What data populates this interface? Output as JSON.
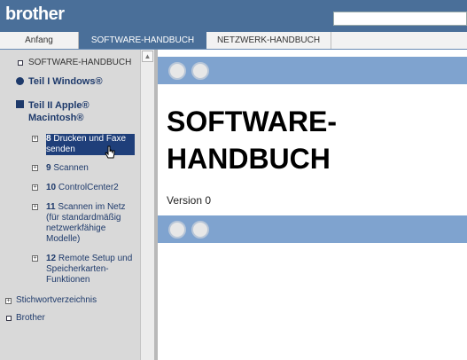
{
  "header": {
    "logo": "brother"
  },
  "tabs": [
    {
      "label": "Anfang"
    },
    {
      "label": "SOFTWARE-HANDBUCH"
    },
    {
      "label": "NETZWERK-HANDBUCH"
    }
  ],
  "sidebar": {
    "root": "SOFTWARE-HANDBUCH",
    "teil1": "Teil I Windows®",
    "teil2": "Teil II Apple® Macintosh®",
    "items": [
      {
        "num": "8",
        "label": "Drucken und Faxe senden",
        "selected": true
      },
      {
        "num": "9",
        "label": "Scannen"
      },
      {
        "num": "10",
        "label": "ControlCenter2"
      },
      {
        "num": "11",
        "label": "Scannen im Netz (für standardmäßig netzwerkfähige Modelle)"
      },
      {
        "num": "12",
        "label": "Remote Setup und Speicherkarten-Funktionen"
      }
    ],
    "index": "Stichwortverzeichnis",
    "brother": "Brother"
  },
  "main": {
    "title": "SOFTWARE-HANDBUCH",
    "version": "Version 0"
  },
  "icons": {
    "home": "home-icon",
    "print": "print-icon"
  },
  "colors": {
    "header": "#4a6f99",
    "band": "#7fa3cf",
    "selection": "#1f3f7a"
  }
}
